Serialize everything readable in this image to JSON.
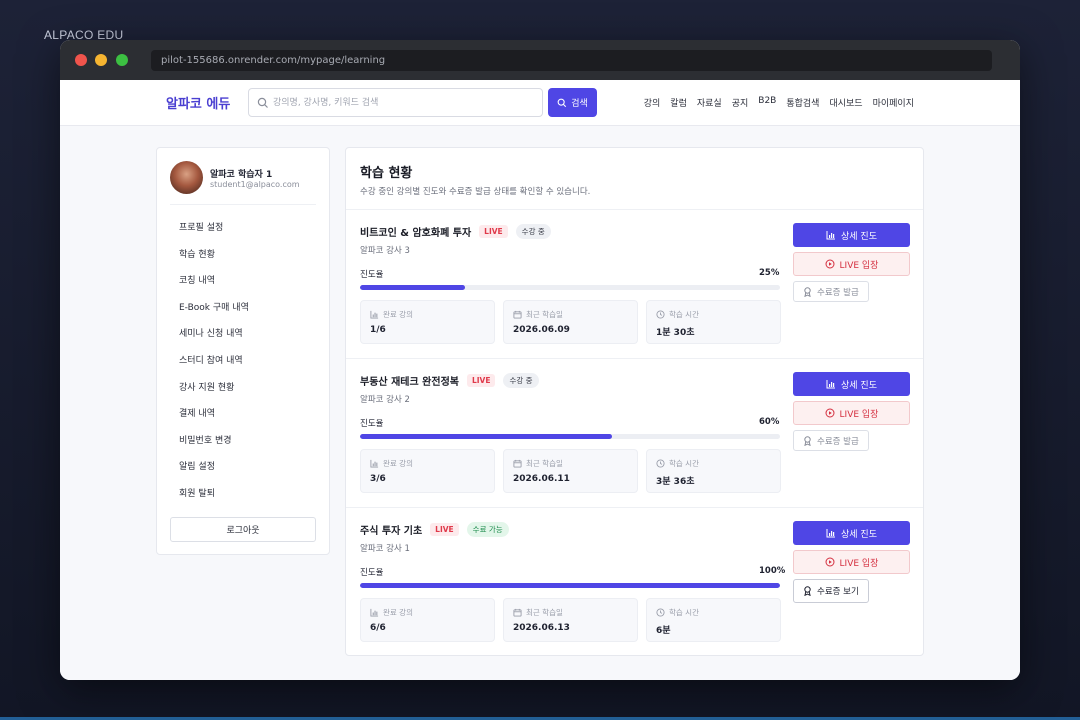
{
  "corner_brand": "ALPACO EDU",
  "browser": {
    "url": "pilot-155686.onrender.com/mypage/learning"
  },
  "nav": {
    "logo": "알파코 에듀",
    "search_placeholder": "강의명, 강사명, 키워드 검색",
    "search_button": "검색",
    "links": [
      "강의",
      "칼럼",
      "자료실",
      "공지",
      "B2B",
      "통합검색",
      "대시보드",
      "마이페이지"
    ]
  },
  "profile": {
    "name": "알파코 학습자 1",
    "email": "student1@alpaco.com"
  },
  "sidebar_menu": [
    "프로필 설정",
    "학습 현황",
    "코칭 내역",
    "E-Book 구매 내역",
    "세미나 신청 내역",
    "스터디 참여 내역",
    "강사 지원 현황",
    "결제 내역",
    "비밀번호 변경",
    "알림 설정",
    "회원 탈퇴"
  ],
  "logout_label": "로그아웃",
  "main": {
    "title": "학습 현황",
    "subtitle": "수강 중인 강의별 진도와 수료증 발급 상태를 확인할 수 있습니다."
  },
  "labels": {
    "progress": "진도율",
    "completed_lectures": "완료 강의",
    "last_study": "최근 학습일",
    "study_time": "학습 시간",
    "detail_button": "상세 진도",
    "live_button": "LIVE 입장"
  },
  "colors": {
    "accent": "#4f46e5",
    "live": "#e0394a",
    "done": "#1a8a4a"
  },
  "courses": [
    {
      "title": "비트코인 & 암호화폐 투자",
      "badge_live": "LIVE",
      "status": "수강 중",
      "teacher": "알파코 강사 3",
      "progress": 25,
      "progress_text": "25%",
      "completed": "1/6",
      "last_date": "2026.06.09",
      "time": "1분 30초",
      "cert_label": "수료증 발급"
    },
    {
      "title": "부동산 재테크 완전정복",
      "badge_live": "LIVE",
      "status": "수강 중",
      "teacher": "알파코 강사 2",
      "progress": 60,
      "progress_text": "60%",
      "completed": "3/6",
      "last_date": "2026.06.11",
      "time": "3분 36초",
      "cert_label": "수료증 발급"
    },
    {
      "title": "주식 투자 기초",
      "badge_live": "LIVE",
      "status": "수료 가능",
      "teacher": "알파코 강사 1",
      "progress": 100,
      "progress_text": "100%",
      "completed": "6/6",
      "last_date": "2026.06.13",
      "time": "6분",
      "cert_label": "수료증 보기"
    }
  ]
}
